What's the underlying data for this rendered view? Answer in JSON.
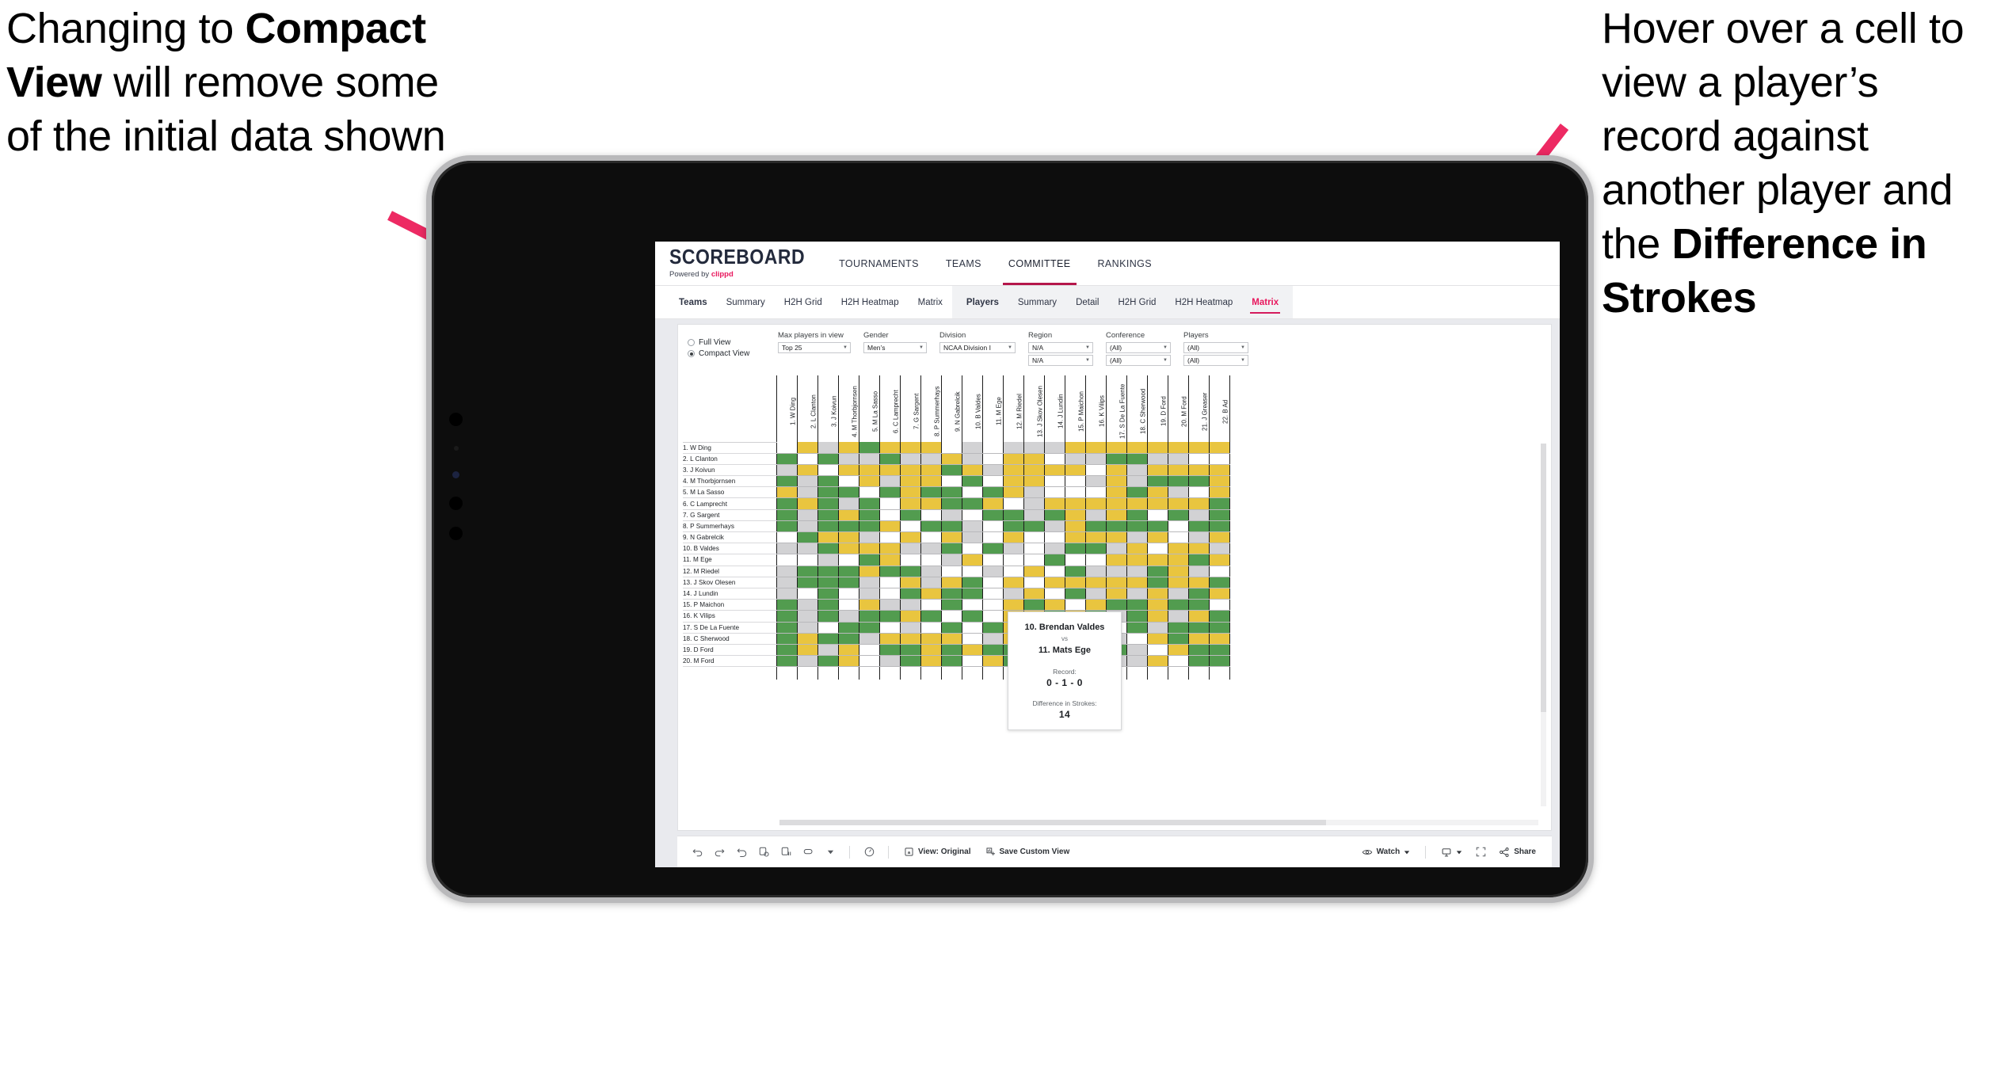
{
  "annotations": {
    "left": {
      "pre": "Changing to ",
      "bold": "Compact View",
      "post": " will remove some of the initial data shown"
    },
    "right": {
      "pre": "Hover over a cell to view a player’s record against another player and the ",
      "bold": "Difference in Strokes",
      "post": ""
    }
  },
  "app": {
    "brand": {
      "title": "SCOREBOARD",
      "powered_prefix": "Powered by ",
      "powered_brand": "clippd"
    },
    "top_nav": [
      {
        "label": "TOURNAMENTS",
        "active": false
      },
      {
        "label": "TEAMS",
        "active": false
      },
      {
        "label": "COMMITTEE",
        "active": true
      },
      {
        "label": "RANKINGS",
        "active": false
      }
    ],
    "sub_nav_left": [
      {
        "label": "Teams",
        "style": "bold"
      },
      {
        "label": "Summary",
        "style": "normal"
      },
      {
        "label": "H2H Grid",
        "style": "normal"
      },
      {
        "label": "H2H Heatmap",
        "style": "normal"
      },
      {
        "label": "Matrix",
        "style": "normal"
      }
    ],
    "sub_nav_right": [
      {
        "label": "Players",
        "style": "bold"
      },
      {
        "label": "Summary",
        "style": "normal"
      },
      {
        "label": "Detail",
        "style": "normal"
      },
      {
        "label": "H2H Grid",
        "style": "normal"
      },
      {
        "label": "H2H Heatmap",
        "style": "normal"
      },
      {
        "label": "Matrix",
        "style": "active"
      }
    ],
    "filters": {
      "view_options": [
        {
          "label": "Full View",
          "selected": false
        },
        {
          "label": "Compact View",
          "selected": true
        }
      ],
      "max_players": {
        "label": "Max players in view",
        "value": "Top 25"
      },
      "gender": {
        "label": "Gender",
        "value": "Men’s"
      },
      "division": {
        "label": "Division",
        "value": "NCAA Division I"
      },
      "region": {
        "label": "Region",
        "value": "N/A",
        "value2": "N/A"
      },
      "conference": {
        "label": "Conference",
        "value": "(All)",
        "value2": "(All)"
      },
      "players": {
        "label": "Players",
        "value": "(All)",
        "value2": "(All)"
      }
    },
    "tooltip": {
      "player_a": "10. Brendan Valdes",
      "vs": "vs",
      "player_b": "11. Mats Ege",
      "record_label": "Record:",
      "record_value": "0 - 1 - 0",
      "diff_label": "Difference in Strokes:",
      "diff_value": "14"
    },
    "toolbar": {
      "view_label": "View: Original",
      "save_label": "Save Custom View",
      "watch_label": "Watch",
      "share_label": "Share"
    }
  },
  "chart_data": {
    "type": "heatmap",
    "title": "Player Head-to-Head Matrix",
    "legend": {
      "green": "#529c4f",
      "yellow": "#e9c53f",
      "gray": "#d2d2d4",
      "white": "#ffffff"
    },
    "columns": [
      "1. W Ding",
      "2. L Clanton",
      "3. J Koivun",
      "4. M Thorbjornsen",
      "5. M La Sasso",
      "6. C Lamprecht",
      "7. G Sargent",
      "8. P Summerhays",
      "9. N Gabrelcik",
      "10. B Valdes",
      "11. M Ege",
      "12. M Riedel",
      "13. J Skov Olesen",
      "14. J Lundin",
      "15. P Maichon",
      "16. K Vilips",
      "17. S De La Fuente",
      "18. C Sherwood",
      "19. D Ford",
      "20. M Ford",
      "21. J Greaser",
      "22. B Ad"
    ],
    "rows": [
      "1. W Ding",
      "2. L Clanton",
      "3. J Koivun",
      "4. M Thorbjornsen",
      "5. M La Sasso",
      "6. C Lamprecht",
      "7. G Sargent",
      "8. P Summerhays",
      "9. N Gabrelcik",
      "10. B Valdes",
      "11. M Ege",
      "12. M Riedel",
      "13. J Skov Olesen",
      "14. J Lundin",
      "15. P Maichon",
      "16. K Vilips",
      "17. S De La Fuente",
      "18. C Sherwood",
      "19. D Ford",
      "20. M Ford"
    ],
    "cells": [
      [
        "w",
        "y",
        "a",
        "y",
        "g",
        "y",
        "y",
        "y",
        "w",
        "a",
        "w",
        "a",
        "a",
        "a",
        "y",
        "y",
        "y",
        "y",
        "y",
        "y",
        "y",
        "y"
      ],
      [
        "g",
        "w",
        "g",
        "a",
        "a",
        "g",
        "a",
        "a",
        "y",
        "a",
        "w",
        "y",
        "y",
        "w",
        "a",
        "a",
        "g",
        "g",
        "a",
        "a",
        "w",
        "w"
      ],
      [
        "a",
        "y",
        "w",
        "y",
        "y",
        "y",
        "y",
        "y",
        "g",
        "y",
        "a",
        "y",
        "y",
        "y",
        "y",
        "w",
        "y",
        "a",
        "y",
        "y",
        "y",
        "y"
      ],
      [
        "g",
        "a",
        "g",
        "w",
        "y",
        "a",
        "y",
        "y",
        "w",
        "g",
        "w",
        "y",
        "y",
        "w",
        "w",
        "a",
        "y",
        "a",
        "g",
        "g",
        "g",
        "y"
      ],
      [
        "y",
        "a",
        "g",
        "g",
        "w",
        "g",
        "y",
        "g",
        "g",
        "w",
        "g",
        "y",
        "a",
        "w",
        "w",
        "w",
        "y",
        "g",
        "y",
        "a",
        "w",
        "y"
      ],
      [
        "g",
        "y",
        "g",
        "a",
        "g",
        "w",
        "y",
        "y",
        "g",
        "g",
        "y",
        "w",
        "a",
        "y",
        "y",
        "y",
        "y",
        "y",
        "y",
        "y",
        "y",
        "g"
      ],
      [
        "g",
        "a",
        "g",
        "y",
        "g",
        "w",
        "g",
        "w",
        "a",
        "w",
        "g",
        "g",
        "a",
        "g",
        "y",
        "a",
        "y",
        "g",
        "w",
        "g",
        "a",
        "g"
      ],
      [
        "g",
        "a",
        "g",
        "g",
        "g",
        "y",
        "w",
        "g",
        "g",
        "a",
        "w",
        "g",
        "g",
        "a",
        "y",
        "g",
        "g",
        "g",
        "g",
        "w",
        "g",
        "g"
      ],
      [
        "w",
        "g",
        "y",
        "y",
        "a",
        "w",
        "y",
        "w",
        "y",
        "a",
        "w",
        "y",
        "w",
        "w",
        "y",
        "y",
        "y",
        "a",
        "y",
        "w",
        "a",
        "y"
      ],
      [
        "a",
        "a",
        "g",
        "y",
        "y",
        "y",
        "a",
        "a",
        "g",
        "w",
        "g",
        "a",
        "w",
        "a",
        "g",
        "g",
        "a",
        "y",
        "w",
        "y",
        "y",
        "a"
      ],
      [
        "w",
        "w",
        "a",
        "w",
        "g",
        "y",
        "w",
        "w",
        "a",
        "y",
        "w",
        "w",
        "w",
        "g",
        "w",
        "w",
        "y",
        "y",
        "y",
        "y",
        "g",
        "y"
      ],
      [
        "a",
        "g",
        "g",
        "g",
        "y",
        "g",
        "g",
        "a",
        "w",
        "w",
        "a",
        "w",
        "y",
        "w",
        "g",
        "a",
        "a",
        "a",
        "g",
        "y",
        "a",
        "w"
      ],
      [
        "a",
        "g",
        "g",
        "g",
        "a",
        "w",
        "y",
        "a",
        "y",
        "g",
        "w",
        "y",
        "w",
        "y",
        "y",
        "y",
        "y",
        "y",
        "g",
        "y",
        "y",
        "g"
      ],
      [
        "a",
        "w",
        "g",
        "w",
        "a",
        "w",
        "g",
        "y",
        "g",
        "g",
        "w",
        "a",
        "y",
        "w",
        "g",
        "a",
        "y",
        "a",
        "y",
        "a",
        "g",
        "y"
      ],
      [
        "g",
        "a",
        "g",
        "w",
        "y",
        "a",
        "a",
        "w",
        "g",
        "w",
        "w",
        "y",
        "g",
        "y",
        "w",
        "y",
        "g",
        "g",
        "y",
        "g",
        "g",
        "w"
      ],
      [
        "g",
        "a",
        "g",
        "a",
        "g",
        "g",
        "y",
        "g",
        "w",
        "g",
        "w",
        "y",
        "y",
        "g",
        "y",
        "g",
        "a",
        "g",
        "y",
        "a",
        "y",
        "g"
      ],
      [
        "g",
        "a",
        "w",
        "g",
        "g",
        "w",
        "a",
        "w",
        "g",
        "w",
        "g",
        "y",
        "y",
        "g",
        "g",
        "g",
        "w",
        "g",
        "a",
        "g",
        "g",
        "g"
      ],
      [
        "g",
        "y",
        "g",
        "g",
        "a",
        "y",
        "y",
        "y",
        "y",
        "w",
        "a",
        "y",
        "y",
        "a",
        "g",
        "g",
        "a",
        "w",
        "y",
        "g",
        "y",
        "y"
      ],
      [
        "g",
        "y",
        "a",
        "y",
        "w",
        "g",
        "g",
        "y",
        "g",
        "y",
        "g",
        "g",
        "w",
        "a",
        "g",
        "g",
        "g",
        "a",
        "w",
        "y",
        "g",
        "g"
      ],
      [
        "g",
        "a",
        "g",
        "y",
        "w",
        "a",
        "g",
        "y",
        "g",
        "w",
        "y",
        "g",
        "y",
        "g",
        "w",
        "g",
        "a",
        "a",
        "y",
        "w",
        "g",
        "g"
      ]
    ]
  }
}
